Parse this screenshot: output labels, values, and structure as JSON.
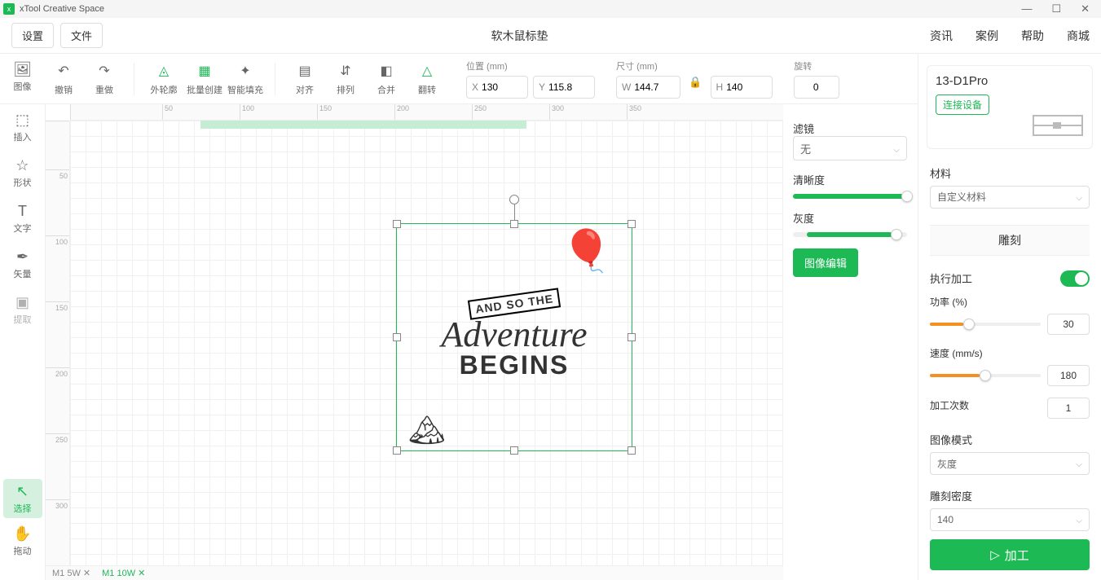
{
  "app_title": "xTool Creative Space",
  "menubar": {
    "settings": "设置",
    "file": "文件",
    "doc_title": "软木鼠标垫",
    "links": {
      "news": "资讯",
      "cases": "案例",
      "help": "帮助",
      "store": "商城"
    }
  },
  "toolbar": {
    "undo": "撤销",
    "redo": "重做",
    "outline": "外轮廓",
    "batch": "批量创建",
    "smartfill": "智能填充",
    "align": "对齐",
    "arrange": "排列",
    "combine": "合并",
    "flip": "翻转",
    "pos_label": "位置 (mm)",
    "x_prefix": "X",
    "x_val": "130",
    "y_prefix": "Y",
    "y_val": "115.8",
    "size_label": "尺寸 (mm)",
    "w_prefix": "W",
    "w_val": "144.7",
    "h_prefix": "H",
    "h_val": "140",
    "rot_label": "旋转",
    "rot_val": "0"
  },
  "sidebar": {
    "image": "图像",
    "insert": "插入",
    "shape": "形状",
    "text": "文字",
    "vector": "矢量",
    "extract": "提取",
    "select": "选择",
    "drag": "拖动"
  },
  "canvas": {
    "art_banner": "AND SO THE",
    "art_main": "Adventure",
    "art_sub": "BEGINS"
  },
  "img_panel": {
    "filter_label": "滤镜",
    "filter_value": "无",
    "sharp_label": "清晰度",
    "gray_label": "灰度",
    "edit_btn": "图像编辑"
  },
  "right": {
    "device_name": "13-D1Pro",
    "connect": "连接设备",
    "material_label": "材料",
    "material_value": "自定义材料",
    "engrave_tab": "雕刻",
    "process_label": "执行加工",
    "power_label": "功率 (%)",
    "power_val": "30",
    "speed_label": "速度 (mm/s)",
    "speed_val": "180",
    "passes_label": "加工次数",
    "passes_val": "1",
    "img_mode_label": "图像模式",
    "img_mode_val": "灰度",
    "density_label": "雕刻密度",
    "density_val": "140",
    "process_btn": "加工"
  },
  "bottom_tabs": {
    "t1": "M1 5W",
    "t2": "M1 10W"
  },
  "ruler_h": [
    "50",
    "100",
    "150",
    "200",
    "250",
    "300",
    "350"
  ],
  "ruler_v": [
    "50",
    "100",
    "150",
    "200",
    "250",
    "300"
  ]
}
